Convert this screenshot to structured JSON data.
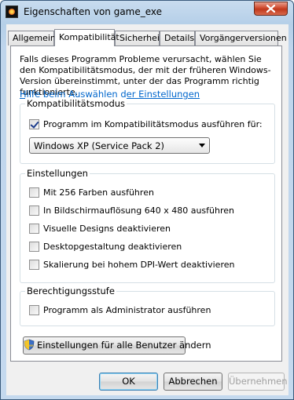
{
  "window": {
    "title": "Eigenschaften von game_exe"
  },
  "tabs": [
    {
      "label": "Allgemein",
      "active": false
    },
    {
      "label": "Kompatibilität",
      "active": true
    },
    {
      "label": "Sicherheit",
      "active": false
    },
    {
      "label": "Details",
      "active": false
    },
    {
      "label": "Vorgängerversionen",
      "active": false
    }
  ],
  "compat": {
    "description": "Falls dieses Programm Probleme verursacht, wählen Sie den Kompatibilitätsmodus, der mit der früheren Windows- Version übereinstimmt, unter der das Programm richtig funktionierte.",
    "help_link": "Hilfe beim Auswählen der Einstellungen",
    "mode_group": {
      "title": "Kompatibilitätsmodus",
      "checkbox_label": "Programm im Kompatibilitätsmodus ausführen für:",
      "checked": true,
      "selected_os": "Windows XP (Service Pack 2)"
    },
    "settings_group": {
      "title": "Einstellungen",
      "items": [
        {
          "label": "Mit 256 Farben ausführen",
          "checked": false
        },
        {
          "label": "In Bildschirmauflösung 640 x 480 ausführen",
          "checked": false
        },
        {
          "label": "Visuelle Designs deaktivieren",
          "checked": false
        },
        {
          "label": "Desktopgestaltung deaktivieren",
          "checked": false
        },
        {
          "label": "Skalierung bei hohem DPI-Wert deaktivieren",
          "checked": false
        }
      ]
    },
    "privilege_group": {
      "title": "Berechtigungsstufe",
      "checkbox_label": "Programm als Administrator ausführen",
      "checked": false
    },
    "all_users_button": "Einstellungen für alle Benutzer ändern"
  },
  "footer": {
    "ok": "OK",
    "cancel": "Abbrechen",
    "apply": "Übernehmen"
  }
}
